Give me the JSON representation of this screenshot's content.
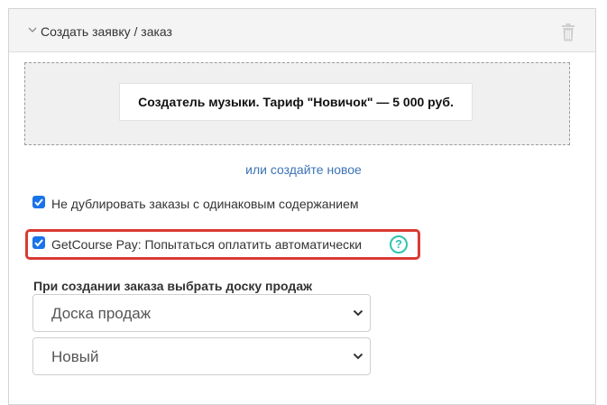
{
  "panel": {
    "title": "Создать заявку / заказ"
  },
  "offer": {
    "title": "Создатель музыки. Тариф \"Новичок\" — 5 000 руб.",
    "create_new_link": "или создайте новое"
  },
  "options": [
    {
      "label": "Не дублировать заказы с одинаковым содержанием",
      "checked": true
    },
    {
      "label": "GetCourse Pay: Попытаться оплатить автоматически",
      "checked": true
    }
  ],
  "sales_board": {
    "label": "При создании заказа выбрать доску продаж",
    "board_selected": "Доска продаж",
    "status_selected": "Новый"
  },
  "icons": {
    "collapse": "chevron-down-icon",
    "delete": "trash-icon",
    "help": "help-circle-icon",
    "select": "chevron-down-icon"
  },
  "colors": {
    "checkbox": "#1a73e8",
    "link": "#3d73b5",
    "highlight": "#d93a32",
    "help": "#2ec4b0"
  }
}
